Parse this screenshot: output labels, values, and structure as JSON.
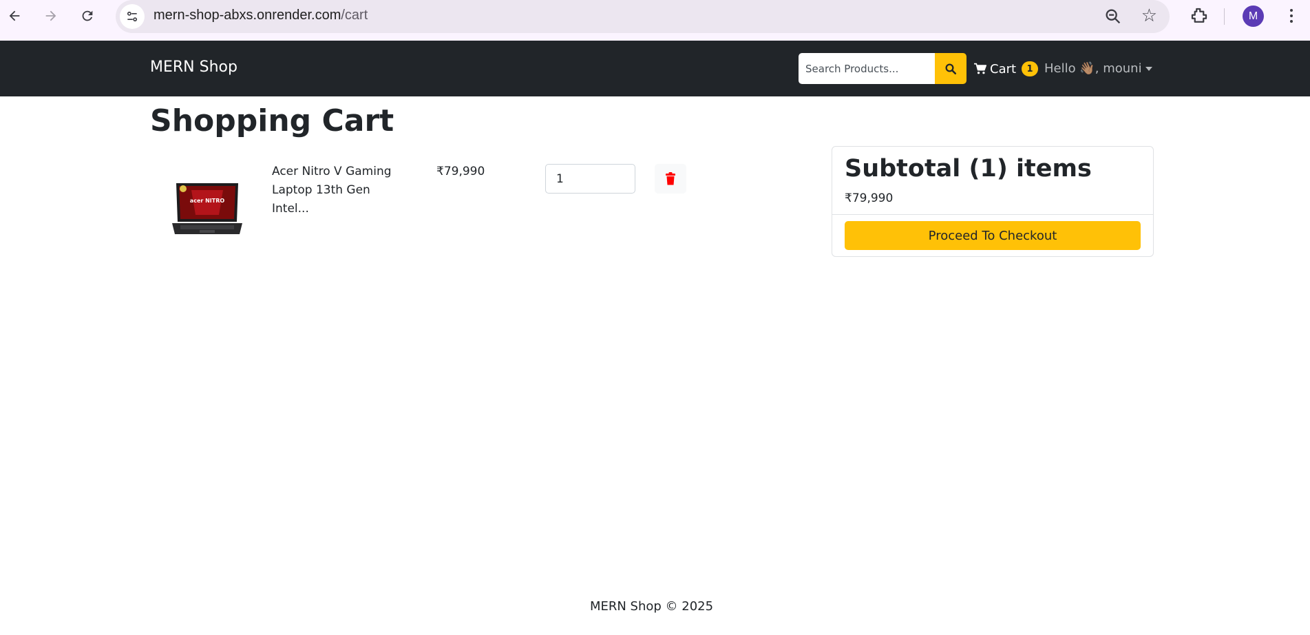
{
  "browser": {
    "url_host": "mern-shop-abxs.onrender.com",
    "url_path": "/cart",
    "profile_initial": "M"
  },
  "navbar": {
    "brand": "MERN Shop",
    "search_placeholder": "Search Products...",
    "cart_label": "Cart",
    "cart_count": "1",
    "user_greeting": "Hello 👋🏽, mouni"
  },
  "page": {
    "title": "Shopping Cart"
  },
  "cart_items": [
    {
      "name": "Acer Nitro V Gaming Laptop 13th Gen Intel...",
      "price": "₹79,990",
      "quantity": "1"
    }
  ],
  "summary": {
    "title": "Subtotal (1) items",
    "total": "₹79,990",
    "checkout_label": "Proceed To Checkout"
  },
  "footer": {
    "text": "MERN Shop © 2025"
  },
  "colors": {
    "navbar_bg": "#212529",
    "accent": "#ffc107",
    "delete_icon": "#ff0000"
  }
}
